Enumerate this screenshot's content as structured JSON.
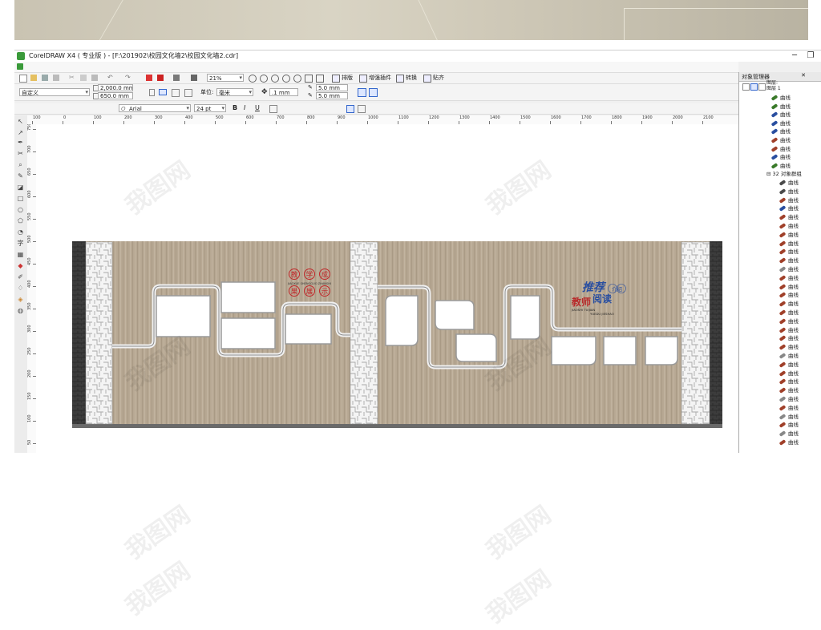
{
  "window": {
    "title": "CorelDRAW X4 ( 专业版 ) - [F:\\201902\\校园文化墙2\\校园文化墙2.cdr]",
    "controls": [
      "─",
      "❐",
      "✕"
    ]
  },
  "toolbar": {
    "zoom": "21%",
    "buttons": [
      "排版",
      "增强插件",
      "转换",
      "贴齐"
    ]
  },
  "propbar": {
    "preset": "自定义",
    "width": "2,000.0 mm",
    "height": "650.0 mm",
    "unit_label": "单位:",
    "unit": "毫米",
    "nudge": ".1 mm",
    "dup_x": "5.0 mm",
    "dup_y": "5.0 mm"
  },
  "textbar": {
    "font": "Arial",
    "size": "24 pt"
  },
  "ruler": {
    "top": [
      "100",
      "0",
      "100",
      "200",
      "300",
      "400",
      "500",
      "600",
      "700",
      "800",
      "900",
      "1000",
      "1100",
      "1200",
      "1300",
      "1400",
      "1500",
      "1600",
      "1700",
      "1800",
      "1900",
      "2000",
      "2100"
    ],
    "left": [
      "750",
      "700",
      "650",
      "600",
      "550",
      "500",
      "450",
      "400",
      "350",
      "300",
      "250",
      "200",
      "150",
      "100",
      "50",
      "0",
      "-50",
      "-100"
    ]
  },
  "design": {
    "title1_chars": [
      "教",
      "学",
      "成",
      "果",
      "展",
      "示"
    ],
    "title1_sub": "JIAOXUE SHENGGUO ZHANSHI",
    "title2_calligraphy": "推荐",
    "title2_small": "介绍",
    "title2_main1": "教师",
    "title2_main2": "阅读",
    "title2_sub1": "JIAOSHI TUIJIAN",
    "title2_sub2": "YUEDU JIESHAO"
  },
  "panel": {
    "title": "对象管理器",
    "layer": "图层:",
    "layer_name": "图层 1",
    "group": "32 对象群组",
    "curve_label": "曲线",
    "top_curves": [
      "#3a7a2a",
      "#3a7a2a",
      "#2a4fa0",
      "#2a4fa0",
      "#2a4fa0",
      "#a0402a",
      "#a0402a",
      "#2a4fa0",
      "#3a7a2a"
    ],
    "group_curves": [
      "#4a4a4a",
      "#4a4a4a",
      "#a0402a",
      "#2a4fa0",
      "#a0402a",
      "#a0402a",
      "#a0402a",
      "#a0402a",
      "#a0402a",
      "#a0402a",
      "#888",
      "#a0402a",
      "#a0402a",
      "#a0402a",
      "#a0402a",
      "#a0402a",
      "#a0402a",
      "#a0402a",
      "#a0402a",
      "#a0402a",
      "#888",
      "#a0402a",
      "#a0402a",
      "#a0402a",
      "#a0402a",
      "#888",
      "#a0402a",
      "#888",
      "#a0402a",
      "#888",
      "#a0402a",
      "#888",
      "#a0402a",
      "#a0402a",
      "#888",
      "#a0402a",
      "#a0402a",
      "#a0402a",
      "#a0402a",
      "#a0402a"
    ]
  },
  "watermark": "我图网"
}
